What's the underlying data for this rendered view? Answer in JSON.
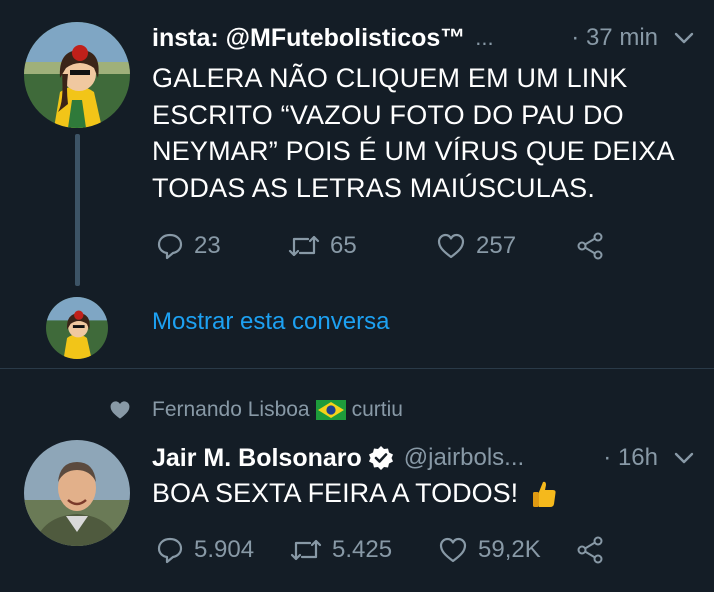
{
  "tweet1": {
    "display_name": "insta: @MFutebolisticos™",
    "truncation": "...",
    "time": "· 37 min",
    "text_lines": [
      "GALERA NÃO CLIQUEM EM UM LINK",
      "ESCRITO “VAZOU FOTO DO PAU DO",
      "NEYMAR” POIS É UM VÍRUS QUE DEIXA",
      "TODAS AS LETRAS MAIÚSCULAS."
    ],
    "replies": "23",
    "retweets": "65",
    "likes": "257"
  },
  "thread": {
    "show_conversation": "Mostrar esta conversa"
  },
  "liked_by": {
    "user": "Fernando Lisboa",
    "flag_icon": "brazil-flag-icon",
    "action": "curtiu"
  },
  "tweet2": {
    "display_name": "Jair M. Bolsonaro",
    "verified_icon": "verified-badge-icon",
    "handle": "@jairbols...",
    "time": "· 16h",
    "text": "BOA SEXTA FEIRA A TODOS!",
    "emoji_icon": "thumbs-up-icon",
    "replies": "5.904",
    "retweets": "5.425",
    "likes": "59,2K"
  },
  "colors": {
    "background": "#141d26",
    "secondary_text": "#8899a6",
    "link": "#1da1f2",
    "thread_line": "#3d5466"
  }
}
